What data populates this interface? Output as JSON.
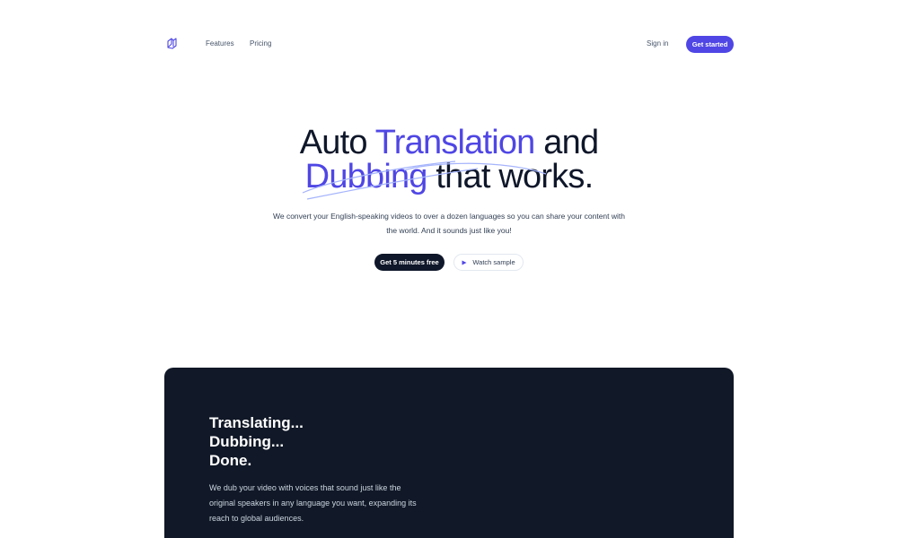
{
  "nav": {
    "logo_icon": "translate-logo-icon",
    "links": [
      "Features",
      "Pricing"
    ],
    "signin_label": "Sign in",
    "cta_label": "Get started"
  },
  "hero": {
    "headline_part1": "Auto ",
    "headline_accent1": "Translation",
    "headline_part2": " and",
    "headline_accent2": "Dubbing",
    "headline_part3": " that works.",
    "subtext": "We convert your English-speaking videos to over a dozen languages so you can share your content with the world. And it sounds just like you!",
    "primary_cta": "Get 5 minutes free",
    "secondary_cta": "Watch sample",
    "secondary_icon": "play-icon"
  },
  "feature": {
    "title_lines": [
      "Translating...",
      "Dubbing...",
      "Done."
    ],
    "description": "We dub your video with voices that sound just like the original speakers in any language you want, expanding its reach to global audiences."
  },
  "colors": {
    "accent": "#4f46e5",
    "dark": "#111827",
    "text": "#0f172a"
  }
}
